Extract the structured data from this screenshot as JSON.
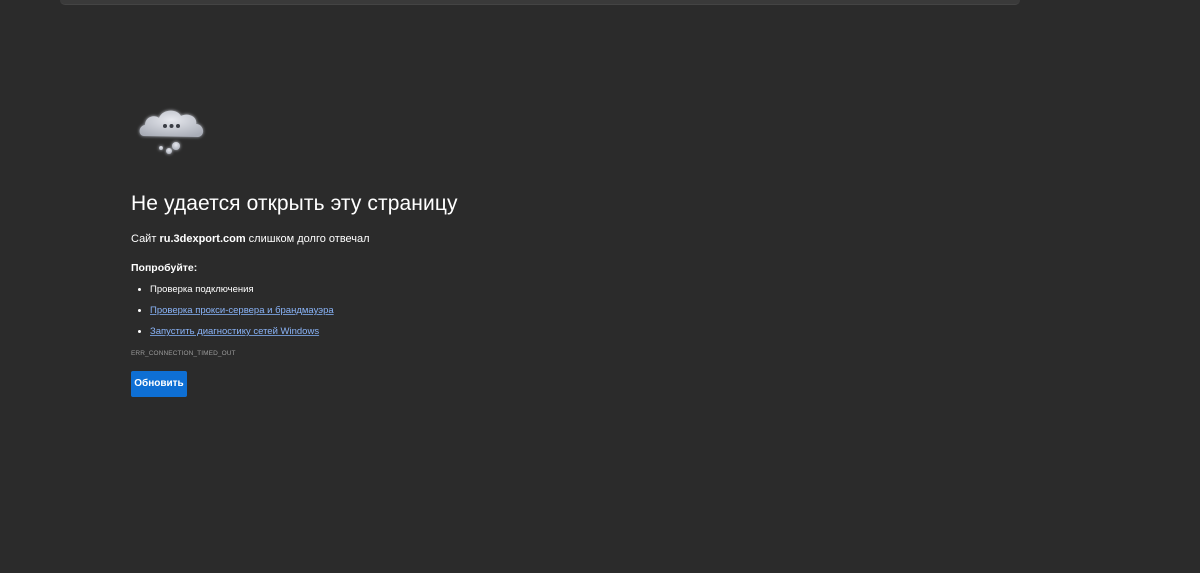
{
  "error_page": {
    "icon": "cloud-thinking-icon",
    "title": "Не удается открыть эту страницу",
    "subtitle_prefix": "Сайт ",
    "subtitle_host": "ru.3dexport.com",
    "subtitle_suffix": " слишком долго отвечал",
    "try_heading": "Попробуйте:",
    "suggestions": [
      {
        "label": "Проверка подключения",
        "link": false
      },
      {
        "label": "Проверка прокси-сервера и брандмауэра",
        "link": true
      },
      {
        "label": "Запустить диагностику сетей Windows",
        "link": true
      }
    ],
    "error_code": "ERR_CONNECTION_TIMED_OUT",
    "refresh_label": "Обновить"
  },
  "colors": {
    "background": "#2b2b2b",
    "link": "#8ab4f8",
    "button": "#0e6fd4"
  }
}
